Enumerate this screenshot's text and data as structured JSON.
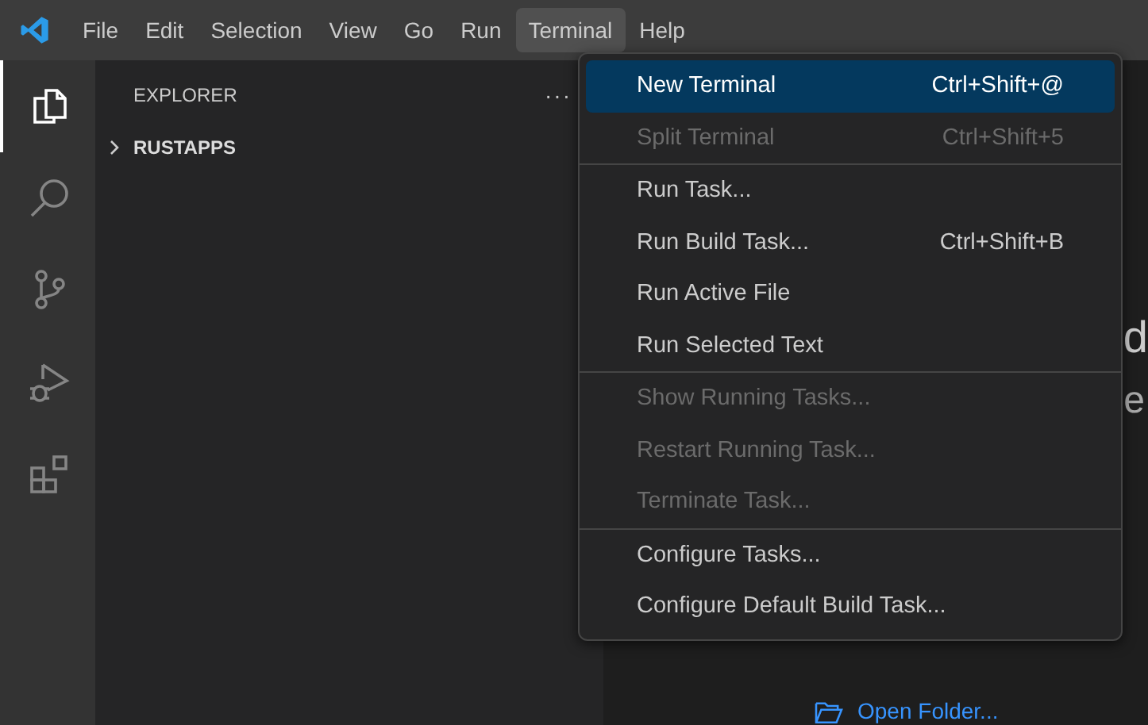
{
  "menu_bar": [
    {
      "label": "File",
      "selected": false
    },
    {
      "label": "Edit",
      "selected": false
    },
    {
      "label": "Selection",
      "selected": false
    },
    {
      "label": "View",
      "selected": false
    },
    {
      "label": "Go",
      "selected": false
    },
    {
      "label": "Run",
      "selected": false
    },
    {
      "label": "Terminal",
      "selected": true
    },
    {
      "label": "Help",
      "selected": false
    }
  ],
  "activity_bar": [
    {
      "kind": "explorer",
      "selected": true
    },
    {
      "kind": "search",
      "selected": false
    },
    {
      "kind": "source-control",
      "selected": false
    },
    {
      "kind": "run-debug",
      "selected": false
    },
    {
      "kind": "extensions",
      "selected": false
    }
  ],
  "sidebar": {
    "title": "EXPLORER",
    "more": "···",
    "folder": {
      "label": "RUSTAPPS",
      "expanded": false
    }
  },
  "editor": {
    "fragments": [
      "d",
      "e"
    ],
    "link": "Open Folder..."
  },
  "terminal_menu": [
    {
      "kind": "item",
      "label": "New Terminal",
      "shortcut": "Ctrl+Shift+@",
      "disabled": false,
      "selected": true
    },
    {
      "kind": "item",
      "label": "Split Terminal",
      "shortcut": "Ctrl+Shift+5",
      "disabled": true,
      "selected": false
    },
    {
      "kind": "separator"
    },
    {
      "kind": "item",
      "label": "Run Task...",
      "disabled": false,
      "selected": false
    },
    {
      "kind": "item",
      "label": "Run Build Task...",
      "shortcut": "Ctrl+Shift+B",
      "disabled": false,
      "selected": false
    },
    {
      "kind": "item",
      "label": "Run Active File",
      "disabled": false,
      "selected": false
    },
    {
      "kind": "item",
      "label": "Run Selected Text",
      "disabled": false,
      "selected": false
    },
    {
      "kind": "separator"
    },
    {
      "kind": "item",
      "label": "Show Running Tasks...",
      "disabled": true,
      "selected": false
    },
    {
      "kind": "item",
      "label": "Restart Running Task...",
      "disabled": true,
      "selected": false
    },
    {
      "kind": "item",
      "label": "Terminate Task...",
      "disabled": true,
      "selected": false
    },
    {
      "kind": "separator"
    },
    {
      "kind": "item",
      "label": "Configure Tasks...",
      "disabled": false,
      "selected": false
    },
    {
      "kind": "item",
      "label": "Configure Default Build Task...",
      "disabled": false,
      "selected": false
    }
  ]
}
